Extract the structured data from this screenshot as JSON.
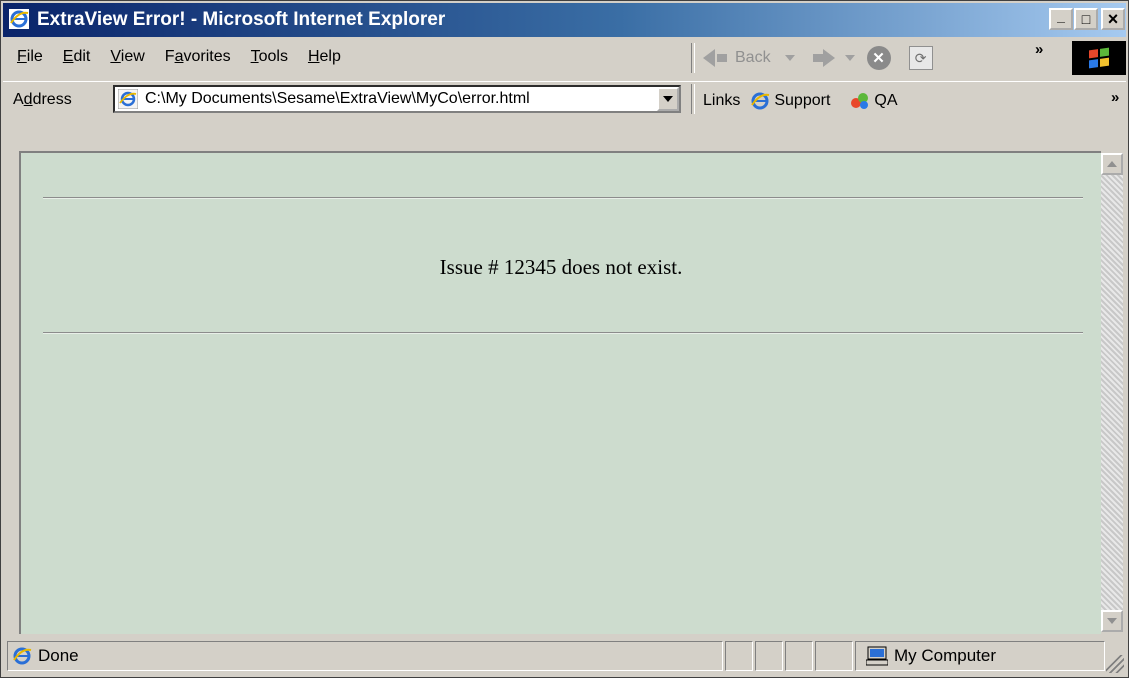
{
  "window": {
    "title": "ExtraView Error! - Microsoft Internet Explorer",
    "controls": {
      "minimize": "_",
      "maximize": "□",
      "close": "×"
    }
  },
  "menu": {
    "items": [
      {
        "label": "File",
        "accel": "F",
        "rest": "ile"
      },
      {
        "label": "Edit",
        "accel": "E",
        "rest": "dit"
      },
      {
        "label": "View",
        "accel": "V",
        "rest": "iew"
      },
      {
        "label": "Favorites",
        "pre": "F",
        "accel": "a",
        "rest": "vorites"
      },
      {
        "label": "Tools",
        "accel": "T",
        "rest": "ools"
      },
      {
        "label": "Help",
        "accel": "H",
        "rest": "elp"
      }
    ]
  },
  "toolbar": {
    "back_label": "Back",
    "chevron": "»"
  },
  "address_bar": {
    "label_pre": "A",
    "label_accel": "d",
    "label_rest": "dress",
    "value": "C:\\My Documents\\Sesame\\ExtraView\\MyCo\\error.html"
  },
  "links_bar": {
    "label": "Links",
    "items": [
      {
        "label": "Support",
        "icon": "ie-icon"
      },
      {
        "label": "QA",
        "icon": "qa-icon"
      }
    ],
    "chevron": "»"
  },
  "page": {
    "background": "#cddcce",
    "message": "Issue # 12345 does not exist."
  },
  "status_bar": {
    "text": "Done",
    "zone": "My Computer"
  }
}
